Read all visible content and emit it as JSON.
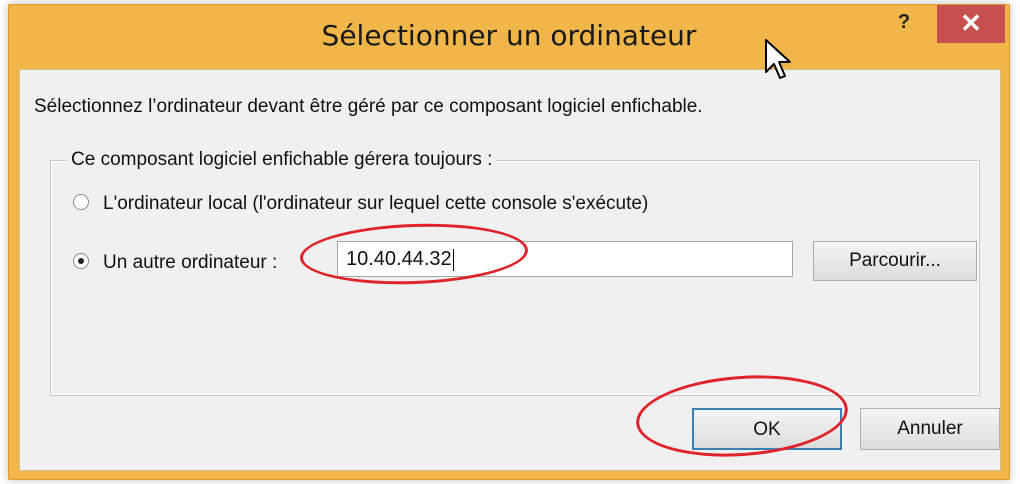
{
  "window": {
    "title": "Sélectionner un ordinateur",
    "help_label": "?",
    "close_label": "✕",
    "accent_color": "#f0b64a",
    "close_color": "#c7504f"
  },
  "dialog": {
    "description": "Sélectionnez l’ordinateur devant être géré par ce composant logiciel enfichable.",
    "group_label": "Ce composant logiciel enfichable gérera toujours :",
    "options": [
      {
        "label": "L'ordinateur local (l'ordinateur sur lequel cette console s'exécute)",
        "checked": false
      },
      {
        "label": "Un autre ordinateur :",
        "checked": true
      }
    ],
    "computer_value": "10.40.44.32",
    "browse_label": "Parcourir...",
    "ok_label": "OK",
    "cancel_label": "Annuler"
  },
  "annotation_color": "#e0232a"
}
